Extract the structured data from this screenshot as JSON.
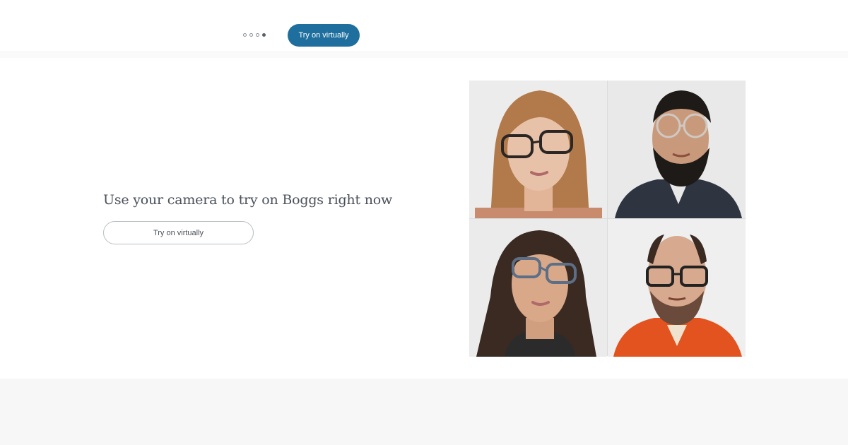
{
  "header": {
    "carousel_dots": [
      false,
      false,
      false,
      true
    ],
    "cta_label": "Try on virtually"
  },
  "promo": {
    "headline": "Use your camera to try on Boggs right now",
    "button_label": "Try on virtually"
  },
  "photo_grid": {
    "tiles": [
      {
        "name": "woman-tortoise-glasses",
        "hair": "#b27a4a",
        "skin": "#e8c2a8",
        "shirt": "#c98b6e",
        "frame": "#2b2624",
        "bg": "#ececec"
      },
      {
        "name": "man-clear-glasses",
        "hair": "#1e1a18",
        "skin": "#c9997c",
        "shirt": "#2e3440",
        "frame": "#cfc9c2",
        "bg": "#e9e9ea"
      },
      {
        "name": "woman-blue-glasses",
        "hair": "#3a2a22",
        "skin": "#d9a889",
        "shirt": "#2b2b2b",
        "frame": "#5d6f86",
        "bg": "#ebebeb"
      },
      {
        "name": "man-orange-jacket",
        "hair": "#3b2a22",
        "skin": "#d7a98e",
        "shirt": "#e2531f",
        "frame": "#222222",
        "bg": "#efefef"
      }
    ]
  },
  "colors": {
    "primary_button": "#1f6f9e",
    "footer_band": "#f7f7f7"
  }
}
